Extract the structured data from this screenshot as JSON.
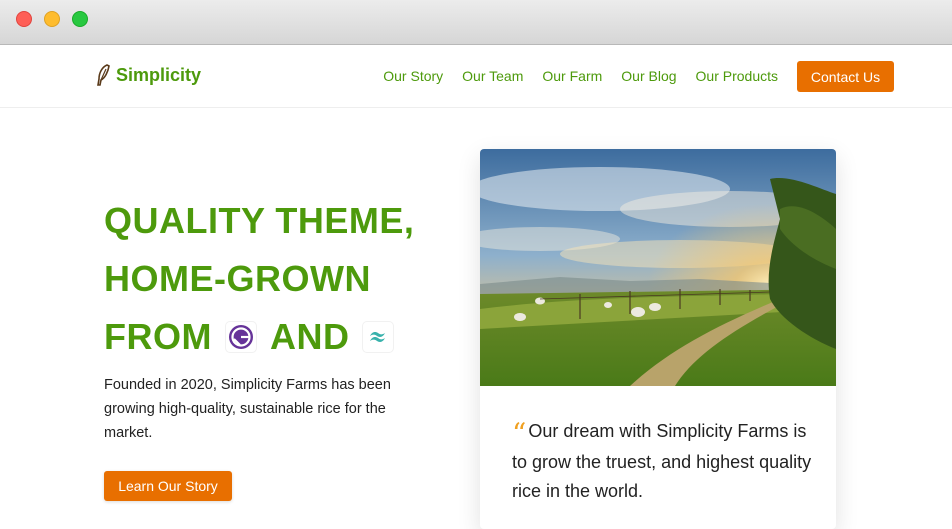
{
  "brand": {
    "name": "Simplicity",
    "color": "#4d9a0c",
    "icon": "quill-icon"
  },
  "nav": {
    "items": [
      {
        "label": "Our Story"
      },
      {
        "label": "Our Team"
      },
      {
        "label": "Our Farm"
      },
      {
        "label": "Our Blog"
      },
      {
        "label": "Our Products"
      }
    ],
    "cta_label": "Contact Us"
  },
  "hero": {
    "line1": "QUALITY THEME,",
    "line2": "HOME-GROWN",
    "line3_prefix": "FROM",
    "line3_mid": "AND",
    "logo1": "gatsby-logo-icon",
    "logo2": "tailwind-logo-icon",
    "description": "Founded in 2020, Simplicity Farms has been growing high-quality, sustainable rice for the market.",
    "button_label": "Learn Our Story"
  },
  "card": {
    "image": "farm-sunset-photo",
    "quote_mark": "“",
    "quote": "Our dream with Simplicity Farms is to grow the truest, and highest quality rice in the world."
  },
  "colors": {
    "accent": "#e86f00",
    "green": "#4d9a0c"
  }
}
